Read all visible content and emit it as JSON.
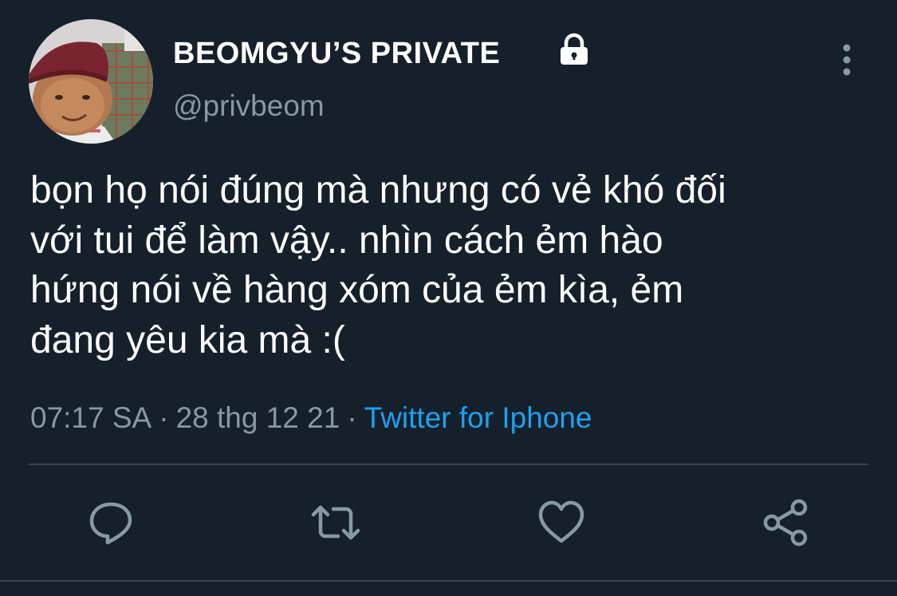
{
  "tweet": {
    "author": {
      "display_name": "BEOMGYU’S PRIVATE",
      "handle": "@privbeom",
      "protected_icon": "lock-icon",
      "avatar_icon": "avatar-photo"
    },
    "text_lines": [
      "bọn họ nói đúng mà nhưng có vẻ khó đối",
      "với tui để làm vậy.. nhìn cách ẻm hào",
      "hứng nói về hàng xóm của ẻm kìa, ẻm",
      "đang yêu kia mà :("
    ],
    "time": "07:17 SA",
    "separator": "·",
    "date": "28 thg 12 21",
    "source": "Twitter for Iphone",
    "menu_icon": "more-vertical-icon"
  },
  "actions": [
    {
      "name": "reply",
      "icon": "reply-icon"
    },
    {
      "name": "retweet",
      "icon": "retweet-icon"
    },
    {
      "name": "like",
      "icon": "heart-icon"
    },
    {
      "name": "share",
      "icon": "share-icon"
    }
  ],
  "colors": {
    "background": "#15202b",
    "primary_text": "#ffffff",
    "secondary_text": "#8899a6",
    "link": "#1da1f2",
    "divider": "#38444d"
  }
}
